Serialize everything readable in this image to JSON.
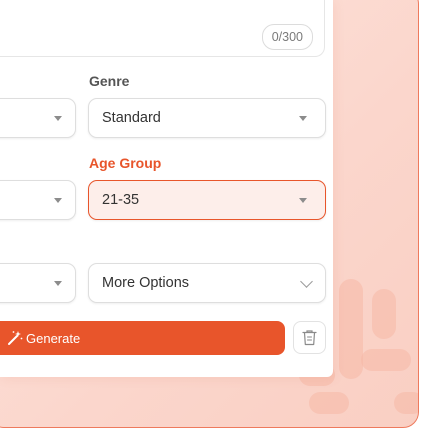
{
  "textarea": {
    "counter": "0/300"
  },
  "fields": {
    "genre": {
      "label": "Genre",
      "value": "Standard"
    },
    "age_group": {
      "label": "Age Group",
      "value": "21-35"
    },
    "more_options": {
      "value": "More Options"
    }
  },
  "actions": {
    "generate_label": "Generate"
  },
  "colors": {
    "accent": "#e8552b",
    "background": "#fde6de"
  },
  "icons": {
    "generate": "magic-wand-icon",
    "delete": "trash-icon"
  }
}
